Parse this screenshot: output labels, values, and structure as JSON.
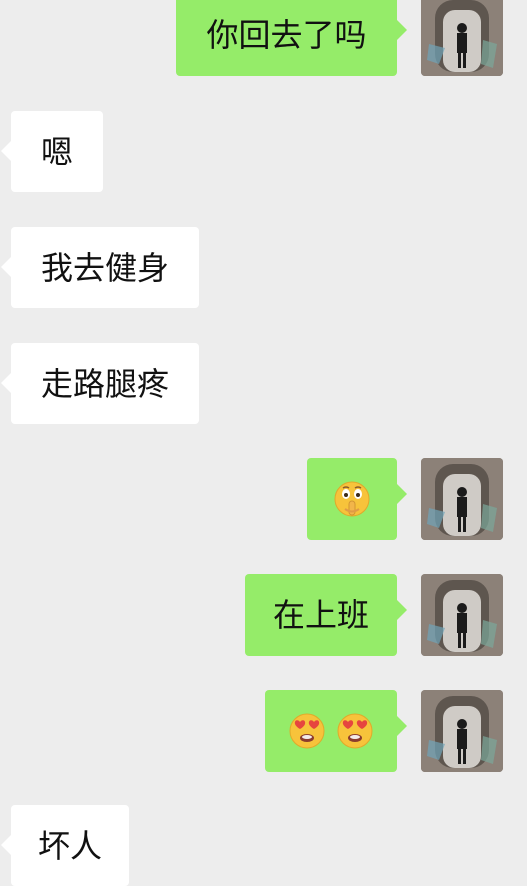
{
  "messages": [
    {
      "side": "out",
      "text": "你回去了吗"
    },
    {
      "side": "in",
      "text": "嗯"
    },
    {
      "side": "in",
      "text": "我去健身"
    },
    {
      "side": "in",
      "text": "走路腿疼"
    },
    {
      "side": "out",
      "emoji": "shush-face-icon"
    },
    {
      "side": "out",
      "text": "在上班"
    },
    {
      "side": "out",
      "emoji": [
        "heart-eyes-face-icon",
        "heart-eyes-face-icon"
      ]
    },
    {
      "side": "in",
      "text": "坏人"
    }
  ],
  "colors": {
    "background": "#ededed",
    "outgoing_bubble": "#95ec69",
    "incoming_bubble": "#ffffff"
  }
}
